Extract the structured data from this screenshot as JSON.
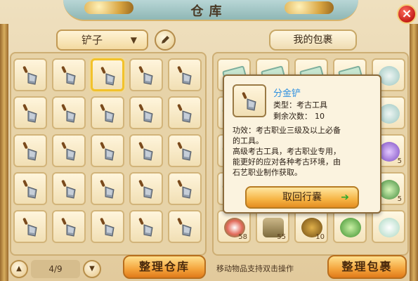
{
  "window": {
    "title": "仓库",
    "close_label": "×"
  },
  "warehouse": {
    "category_label": "铲子",
    "page_label": "4/9",
    "sort_button_label": "整理仓库",
    "slots": 25,
    "selected_index": 2,
    "item_icon": "shovel-icon"
  },
  "bag": {
    "title": "我的包裹",
    "sort_button_label": "整理包裹",
    "hint": "移动物品支持双击操作",
    "counts": {
      "r3c5": "5",
      "r4c5": "5",
      "r5c1": "58",
      "r5c2": "55",
      "r5c3": "10"
    }
  },
  "tooltip": {
    "item_name": "分金铲",
    "type_text": "类型：考古工具",
    "uses_label": "剩余次数：",
    "uses_value": "10",
    "description_lines": [
      "功效：考古职业三级及以上必备",
      "的工具。",
      "高级考古工具，考古职业专用，",
      "能更好的应对各种考古环境，由",
      "石艺职业制作获取。"
    ],
    "action_button_label": "取回行囊"
  },
  "colors": {
    "accent_gold": "#f2c22b",
    "item_name_blue": "#2c8fe0",
    "button_orange": "#f4a43c"
  }
}
